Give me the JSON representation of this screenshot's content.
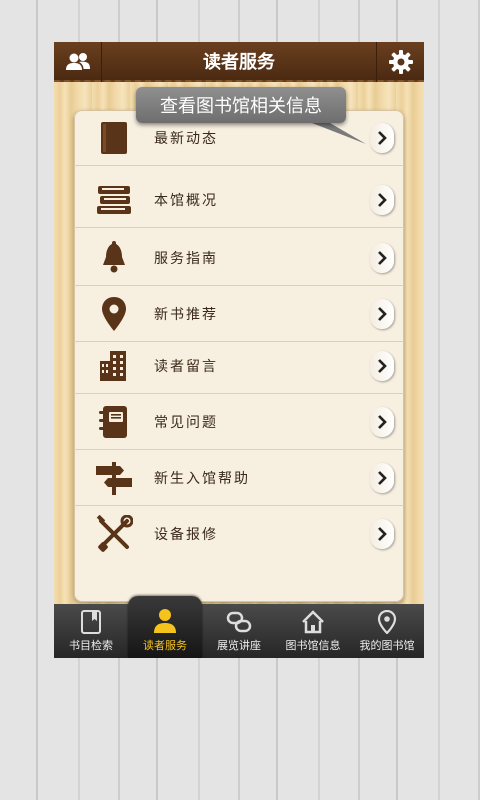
{
  "header": {
    "title": "读者服务",
    "left_icon": "users-icon",
    "right_icon": "gear-icon"
  },
  "tooltip": {
    "text": "查看图书馆相关信息"
  },
  "menu": {
    "items": [
      {
        "label": "最新动态",
        "icon": "book-icon"
      },
      {
        "label": "本馆概况",
        "icon": "books-stack-icon"
      },
      {
        "label": "服务指南",
        "icon": "bell-icon"
      },
      {
        "label": "新书推荐",
        "icon": "location-pin-icon"
      },
      {
        "label": "读者留言",
        "icon": "buildings-icon"
      },
      {
        "label": "常见问题",
        "icon": "notebook-icon"
      },
      {
        "label": "新生入馆帮助",
        "icon": "signpost-icon"
      },
      {
        "label": "设备报修",
        "icon": "tools-icon"
      }
    ]
  },
  "tabs": [
    {
      "label": "书目检索",
      "icon": "bookmark-book-icon",
      "active": false
    },
    {
      "label": "读者服务",
      "icon": "person-icon",
      "active": true
    },
    {
      "label": "展览讲座",
      "icon": "link-icon",
      "active": false
    },
    {
      "label": "图书馆信息",
      "icon": "home-icon",
      "active": false
    },
    {
      "label": "我的图书馆",
      "icon": "location-pin-icon",
      "active": false
    }
  ],
  "colors": {
    "header_brown": "#5a3418",
    "icon_brown": "#5a3418",
    "active_tab": "#f6c21c"
  }
}
